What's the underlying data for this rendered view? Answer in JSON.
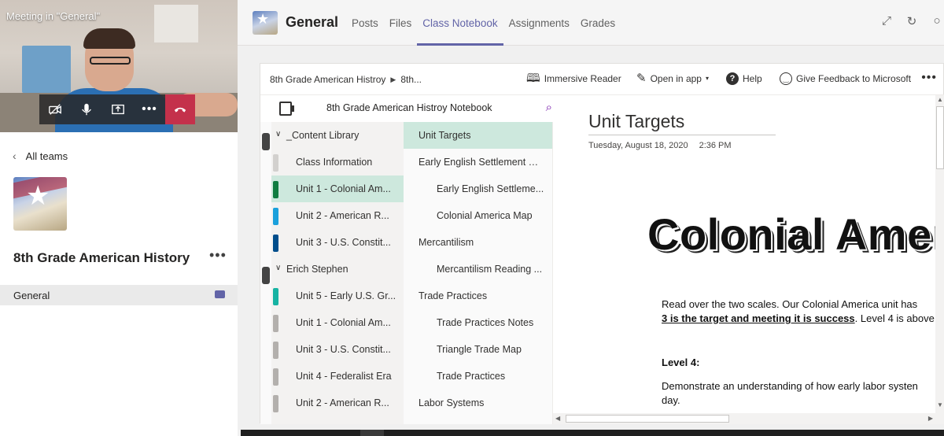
{
  "meeting": {
    "title": "Meeting in \"General\"",
    "controls": [
      {
        "name": "camera-off-icon"
      },
      {
        "name": "microphone-icon"
      },
      {
        "name": "share-screen-icon"
      },
      {
        "name": "more-actions-icon"
      },
      {
        "name": "hang-up-icon"
      }
    ]
  },
  "sidebar": {
    "back_label": "All teams",
    "team_name": "8th Grade American History",
    "channel": "General"
  },
  "header": {
    "channel_title": "General",
    "tabs": [
      "Posts",
      "Files",
      "Class Notebook",
      "Assignments",
      "Grades"
    ],
    "active_tab": "Class Notebook"
  },
  "toolbar": {
    "breadcrumb": [
      "8th Grade American Histroy",
      "8th..."
    ],
    "immersive_reader": "Immersive Reader",
    "open_in_app": "Open in app",
    "help": "Help",
    "feedback": "Give Feedback to Microsoft"
  },
  "notebook": {
    "title": "8th Grade American Histroy Notebook",
    "sections": [
      {
        "label": "_Content Library",
        "group": true,
        "color": ""
      },
      {
        "label": "Class Information",
        "group": false,
        "color": "#d2d0ce"
      },
      {
        "label": "Unit 1 - Colonial Am...",
        "group": false,
        "color": "#107c41",
        "active": true
      },
      {
        "label": "Unit 2 - American R...",
        "group": false,
        "color": "#1aa0dc"
      },
      {
        "label": "Unit 3 - U.S. Constit...",
        "group": false,
        "color": "#004e8c"
      },
      {
        "label": "Erich Stephen",
        "group": true,
        "color": ""
      },
      {
        "label": "Unit 5 - Early U.S. Gr...",
        "group": false,
        "color": "#17b3a3"
      },
      {
        "label": "Unit 1 - Colonial Am...",
        "group": false,
        "color": "#b3b0ad"
      },
      {
        "label": "Unit 3 - U.S. Constit...",
        "group": false,
        "color": "#b3b0ad"
      },
      {
        "label": "Unit 4 - Federalist Era",
        "group": false,
        "color": "#b3b0ad"
      },
      {
        "label": "Unit 2 - American R...",
        "group": false,
        "color": "#b3b0ad"
      }
    ],
    "pages": [
      {
        "label": "Unit Targets",
        "level": 0,
        "active": true
      },
      {
        "label": "Early English Settlement Sli...",
        "level": 0
      },
      {
        "label": "Early English Settleme...",
        "level": 1
      },
      {
        "label": "Colonial America Map",
        "level": 1
      },
      {
        "label": "Mercantilism",
        "level": 0
      },
      {
        "label": "Mercantilism Reading ...",
        "level": 1
      },
      {
        "label": "Trade Practices",
        "level": 0
      },
      {
        "label": "Trade Practices Notes",
        "level": 1
      },
      {
        "label": "Triangle Trade Map",
        "level": 1
      },
      {
        "label": "Trade Practices",
        "level": 1
      },
      {
        "label": "Labor Systems",
        "level": 0
      }
    ]
  },
  "page": {
    "title": "Unit Targets",
    "date": "Tuesday, August 18, 2020",
    "time": "2:36 PM",
    "heading": "Colonial America",
    "para_line1": "Read over the two scales. Our Colonial America unit has",
    "para_line2_bold": "3 is the target and meeting it is success",
    "para_line2_rest": ". Level 4 is above",
    "level_label": "Level 4:",
    "para2_line1": "Demonstrate an understanding of how early labor systen",
    "para2_line2": "day."
  },
  "colors": {
    "accent": "#6264a7",
    "active_section": "#cde8dd",
    "hangup": "#c4314b"
  }
}
